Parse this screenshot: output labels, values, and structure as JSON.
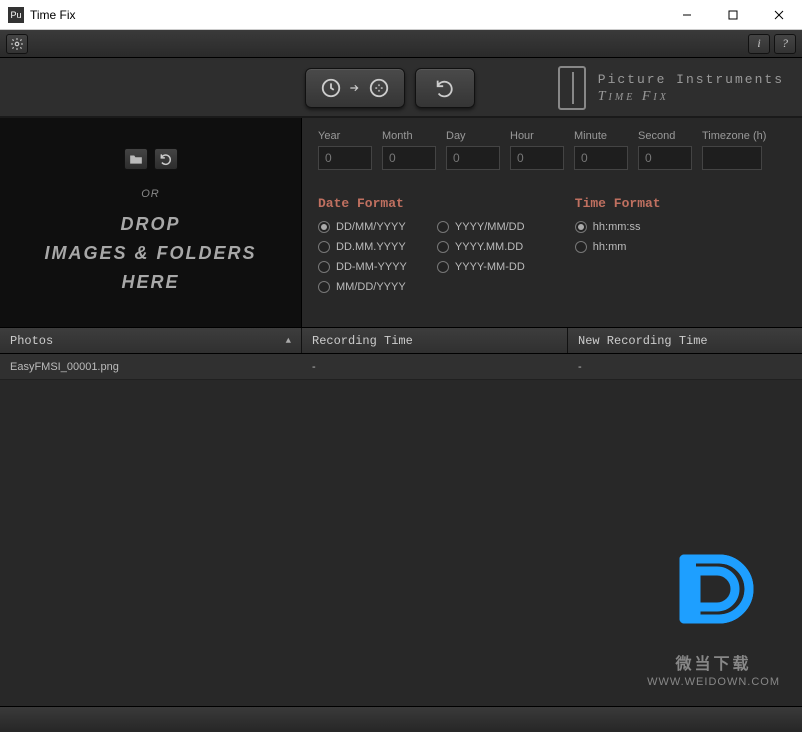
{
  "window": {
    "title": "Time Fix"
  },
  "brand": {
    "line1": "Picture Instruments",
    "line2": "Time Fix"
  },
  "drop": {
    "or": "OR",
    "line1": "DROP",
    "line2": "IMAGES & FOLDERS",
    "line3": "HERE"
  },
  "fields": {
    "year": {
      "label": "Year",
      "value": "0"
    },
    "month": {
      "label": "Month",
      "value": "0"
    },
    "day": {
      "label": "Day",
      "value": "0"
    },
    "hour": {
      "label": "Hour",
      "value": "0"
    },
    "minute": {
      "label": "Minute",
      "value": "0"
    },
    "second": {
      "label": "Second",
      "value": "0"
    },
    "tz": {
      "label": "Timezone (h)",
      "value": ""
    }
  },
  "dateFormat": {
    "title": "Date Format",
    "col1": [
      "DD/MM/YYYY",
      "DD.MM.YYYY",
      "DD-MM-YYYY",
      "MM/DD/YYYY"
    ],
    "col2": [
      "YYYY/MM/DD",
      "YYYY.MM.DD",
      "YYYY-MM-DD"
    ],
    "selected": "DD/MM/YYYY"
  },
  "timeFormat": {
    "title": "Time Format",
    "options": [
      "hh:mm:ss",
      "hh:mm"
    ],
    "selected": "hh:mm:ss"
  },
  "table": {
    "headers": {
      "photos": "Photos",
      "recording": "Recording Time",
      "newRecording": "New Recording Time"
    },
    "rows": [
      {
        "photo": "EasyFMSI_00001.png",
        "recording": "-",
        "newRecording": "-"
      }
    ]
  },
  "watermark": {
    "line1": "微当下载",
    "line2": "WWW.WEIDOWN.COM"
  }
}
